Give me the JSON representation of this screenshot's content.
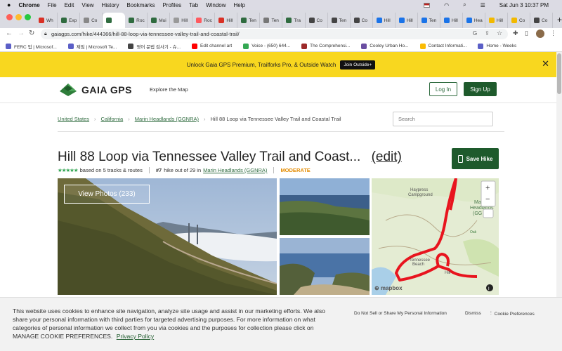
{
  "macos": {
    "app": "Chrome",
    "menus": [
      "File",
      "Edit",
      "View",
      "History",
      "Bookmarks",
      "Profiles",
      "Tab",
      "Window",
      "Help"
    ],
    "datetime": "Sat Jun 3  10:37 PM"
  },
  "tabs": [
    {
      "label": "Wh",
      "color": "#d93025"
    },
    {
      "label": "Exp",
      "color": "#2f6b3f"
    },
    {
      "label": "Co",
      "color": "#888888"
    },
    {
      "label": "",
      "color": "#2f6b3f"
    },
    {
      "label": "Roc",
      "color": "#2f6b3f"
    },
    {
      "label": "Mui",
      "color": "#2f6b3f"
    },
    {
      "label": "Hill",
      "color": "#999999"
    },
    {
      "label": "Roc",
      "color": "#ff5a5f"
    },
    {
      "label": "Hill",
      "color": "#d93025"
    },
    {
      "label": "Ten",
      "color": "#2f6b3f"
    },
    {
      "label": "Ten",
      "color": "#777777"
    },
    {
      "label": "Tra",
      "color": "#2f6b3f"
    },
    {
      "label": "Co",
      "color": "#444444"
    },
    {
      "label": "Ten",
      "color": "#444444"
    },
    {
      "label": "Co",
      "color": "#444444"
    },
    {
      "label": "Hill",
      "color": "#1a73e8"
    },
    {
      "label": "Hill",
      "color": "#1a73e8"
    },
    {
      "label": "Ten",
      "color": "#1a73e8"
    },
    {
      "label": "Hill",
      "color": "#1a73e8"
    },
    {
      "label": "Hea",
      "color": "#1a73e8"
    },
    {
      "label": "Hill",
      "color": "#f2b900"
    },
    {
      "label": "Co",
      "color": "#f2b900"
    },
    {
      "label": "Co",
      "color": "#444444"
    }
  ],
  "address": "gaiagps.com/hike/444366/hill-88-loop-via-tennessee-valley-trail-and-coastal-trail/",
  "bookmarks": [
    {
      "label": "FERC 업 | Microsof...",
      "color": "#5b5fc7"
    },
    {
      "label": "제임 | Microsoft Te...",
      "color": "#5b5fc7"
    },
    {
      "label": "영어 문법 검사기 - 슈...",
      "color": "#444444"
    },
    {
      "label": "Edit channel art",
      "color": "#ff0000"
    },
    {
      "label": "Voice - (650) 644...",
      "color": "#34a853"
    },
    {
      "label": "The Comprehensi...",
      "color": "#9c2a2a"
    },
    {
      "label": "Cooley Urban Ho...",
      "color": "#6a4ea1"
    },
    {
      "label": "Contact Informati...",
      "color": "#fbbc04"
    },
    {
      "label": "Home - Weeks",
      "color": "#5b5fc7"
    }
  ],
  "banner": {
    "text": "Unlock Gaia GPS Premium, Trailforks Pro, & Outside Watch",
    "cta": "Join Outside+"
  },
  "header": {
    "logo": "GAIA GPS",
    "explore": "Explore the Map",
    "login": "Log In",
    "signup": "Sign Up"
  },
  "breadcrumb": [
    "United States",
    "California",
    "Marin Headlands (GGNRA)",
    "Hill 88 Loop via Tennessee Valley Trail and Coastal Trail"
  ],
  "search": {
    "placeholder": "Search"
  },
  "hike": {
    "title": "Hill 88 Loop via Tennessee Valley Trail and Coast...",
    "edit": "(edit)",
    "stars": "★★★★★",
    "based_on": "based on 5 tracks & routes",
    "rank": "#7",
    "rank_text": "hike out of 29 in",
    "area": "Marin Headlands (GGNRA)",
    "difficulty": "MODERATE",
    "save": "Save Hike",
    "view_photos": "View Photos (233)"
  },
  "map": {
    "labels": {
      "haypress": "Haypress\nCampground",
      "marin": "Mar\nHeadlands\n(GG",
      "tbeach": "Tennessee\nBeach",
      "hillb": "Hill\n88",
      "mapbox": "mapbox",
      "oak": "Oak"
    },
    "zoom_in": "+",
    "zoom_out": "−",
    "route_color": "#e8141e"
  },
  "cookie": {
    "text": "This website uses cookies to enhance site navigation, analyze site usage and assist in our marketing efforts. We also share your personal information with third parties for targeted advertising purposes. For more information on what categories of personal information we collect from you via cookies and the purposes for collection please click on MANAGE COOKIE PREFERENCES.",
    "policy": "Privacy Policy",
    "dnsp": "Do Not Sell or Share My Personal Information",
    "dismiss": "Dismiss",
    "prefs": "Cookie Preferences"
  }
}
